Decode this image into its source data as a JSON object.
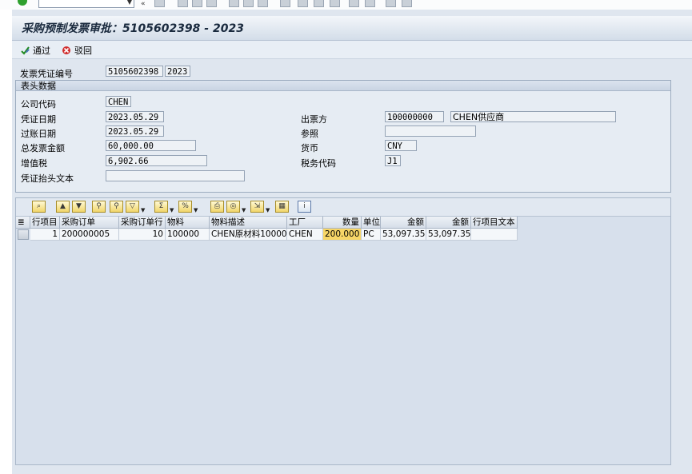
{
  "page": {
    "title": "采购预制发票审批：5105602398 - 2023"
  },
  "toolbar": {
    "approve_label": "通过",
    "reject_label": "驳回"
  },
  "document": {
    "label": "发票凭证编号",
    "number": "5105602398",
    "year": "2023"
  },
  "header_data": {
    "title": "表头数据",
    "company_code": {
      "label": "公司代码",
      "value": "CHEN"
    },
    "doc_date": {
      "label": "凭证日期",
      "value": "2023.05.29"
    },
    "posting_date": {
      "label": "过账日期",
      "value": "2023.05.29"
    },
    "gross_amount": {
      "label": "总发票金额",
      "value": "60,000.00"
    },
    "tax_amount": {
      "label": "增值税",
      "value": "6,902.66"
    },
    "header_text": {
      "label": "凭证抬头文本",
      "value": ""
    },
    "invoicing_party": {
      "label": "出票方",
      "value": "100000000",
      "name": "CHEN供应商"
    },
    "reference": {
      "label": "参照",
      "value": ""
    },
    "currency": {
      "label": "货币",
      "value": "CNY"
    },
    "tax_code": {
      "label": "税务代码",
      "value": "J1"
    }
  },
  "grid": {
    "columns": [
      "行项目",
      "采购订单",
      "采购订单行",
      "物料",
      "物料描述",
      "工厂",
      "数量",
      "单位",
      "金额",
      "金额",
      "行项目文本"
    ],
    "rows": [
      [
        "1",
        "200000005",
        "10",
        "100000",
        "CHEN原材料100000",
        "CHEN",
        "200.000",
        "PC",
        "53,097.35",
        "53,097.35",
        ""
      ]
    ]
  },
  "icons": {
    "approve": "check-pencil-icon",
    "reject": "reject-pencil-icon"
  }
}
